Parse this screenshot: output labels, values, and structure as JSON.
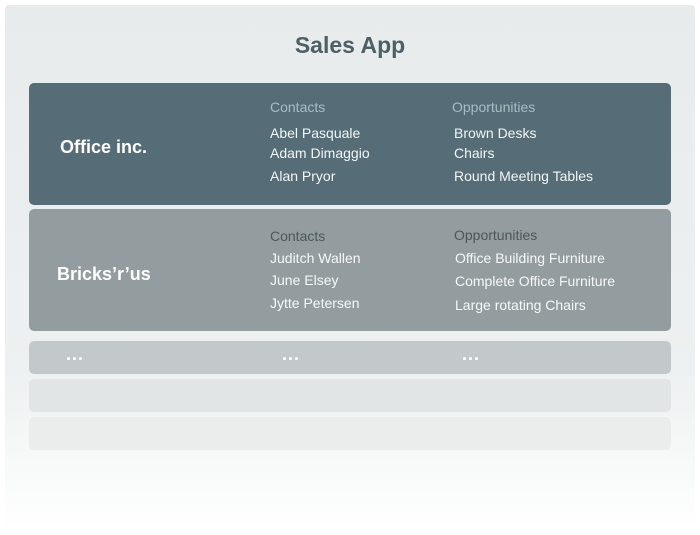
{
  "app": {
    "title": "Sales App"
  },
  "accounts": [
    {
      "company": "Office inc.",
      "contacts_label": "Contacts",
      "contacts": [
        "Abel Pasquale",
        "Adam Dimaggio",
        "Alan Pryor"
      ],
      "opportunities_label": "Opportunities",
      "opportunities": [
        "Brown Desks",
        "Chairs",
        "Round Meeting Tables"
      ]
    },
    {
      "company": "Bricks’r’us",
      "contacts_label": "Contacts",
      "contacts": [
        "Juditch Wallen",
        "June Elsey",
        "Jytte Petersen"
      ],
      "opportunities_label": "Opportunities",
      "opportunities": [
        "Office Building Furniture",
        "Complete Office Furniture",
        "Large rotating Chairs"
      ]
    }
  ],
  "more_row": {
    "company_placeholder": "...",
    "contacts_placeholder": "...",
    "opportunities_placeholder": "..."
  },
  "colors": {
    "selected_row": "#566d77",
    "second_row": "#939d9f",
    "title": "#4f5f66"
  }
}
